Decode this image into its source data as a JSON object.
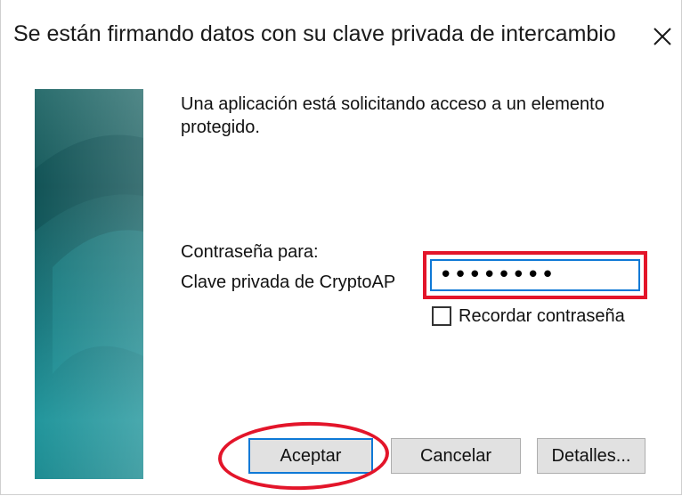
{
  "window": {
    "title": "Se están firmando datos con su clave privada de intercambio"
  },
  "message": "Una aplicación está solicitando acceso a un elemento protegido.",
  "password": {
    "for_label": "Contraseña para:",
    "key_label": "Clave privada de CryptoAP",
    "value": "••••••••"
  },
  "remember": {
    "label": "Recordar contraseña",
    "checked": false
  },
  "buttons": {
    "ok": "Aceptar",
    "cancel": "Cancelar",
    "details": "Detalles..."
  },
  "icons": {
    "close": "close-icon",
    "banner": "banner-graphic"
  },
  "colors": {
    "highlight": "#e3152a",
    "focus": "#0f79d6",
    "banner": "#1c7f86"
  }
}
